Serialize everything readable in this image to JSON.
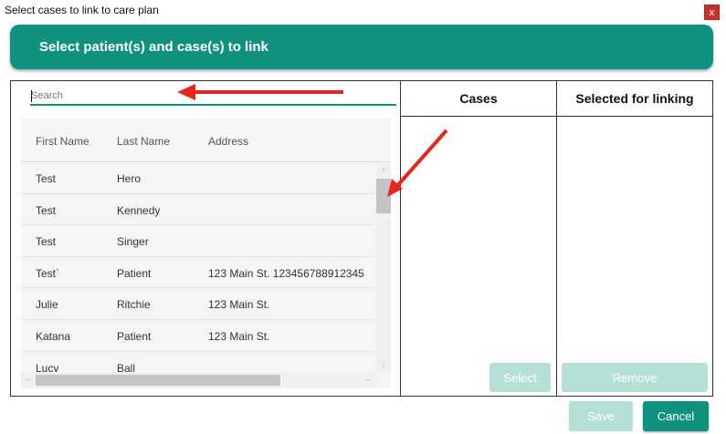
{
  "window": {
    "title": "Select cases to link to care plan",
    "close_label": "x"
  },
  "banner": {
    "title": "Select patient(s) and case(s) to link"
  },
  "search": {
    "placeholder": "Search"
  },
  "grid": {
    "columns": [
      "First Name",
      "Last Name",
      "Address"
    ],
    "rows": [
      {
        "first": "Test",
        "last": "Hero",
        "address": ""
      },
      {
        "first": "Test",
        "last": "Kennedy",
        "address": ""
      },
      {
        "first": "Test",
        "last": "Singer",
        "address": ""
      },
      {
        "first": "Test`",
        "last": "Patient",
        "address": "123 Main St. 123456788912345"
      },
      {
        "first": "Julie",
        "last": "Ritchie",
        "address": "123 Main St."
      },
      {
        "first": "Katana",
        "last": "Patient",
        "address": "123 Main St."
      },
      {
        "first": "Lucy",
        "last": "Ball",
        "address": ""
      }
    ]
  },
  "cases": {
    "header": "Cases",
    "select_label": "Select"
  },
  "selected": {
    "header": "Selected for linking",
    "remove_label": "Remove"
  },
  "footer": {
    "save_label": "Save",
    "cancel_label": "Cancel"
  },
  "annotations": {
    "arrow_color": "#e8251f"
  },
  "colors": {
    "accent": "#10927f",
    "accent_disabled": "#b5e0d8"
  }
}
